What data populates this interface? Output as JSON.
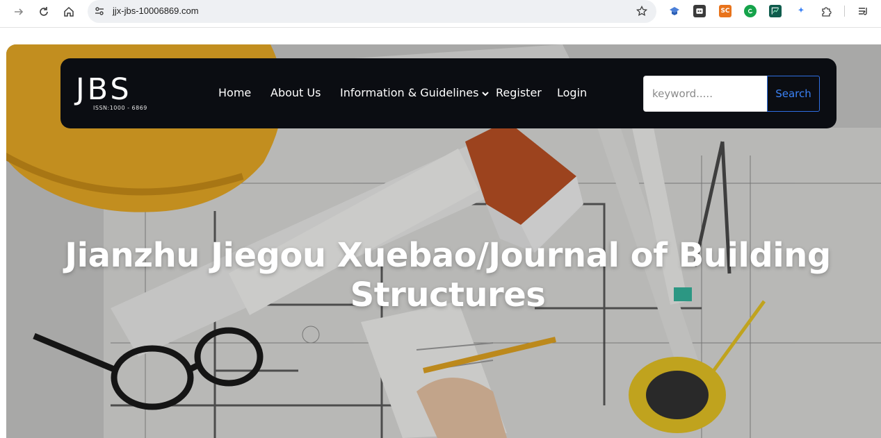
{
  "browser": {
    "url": "jjx-jbs-10006869.com",
    "extension_sc_label": "SC"
  },
  "site": {
    "logo": {
      "text": "JBS",
      "issn": "ISSN:1000 - 6869"
    },
    "nav": {
      "home": "Home",
      "about": "About Us",
      "info": "Information & Guidelines",
      "register": "Register",
      "login": "Login"
    },
    "search": {
      "placeholder": "keyword.....",
      "button": "Search"
    }
  },
  "hero": {
    "title": "Jianzhu Jiegou Xuebao/Journal of Building Structures"
  }
}
